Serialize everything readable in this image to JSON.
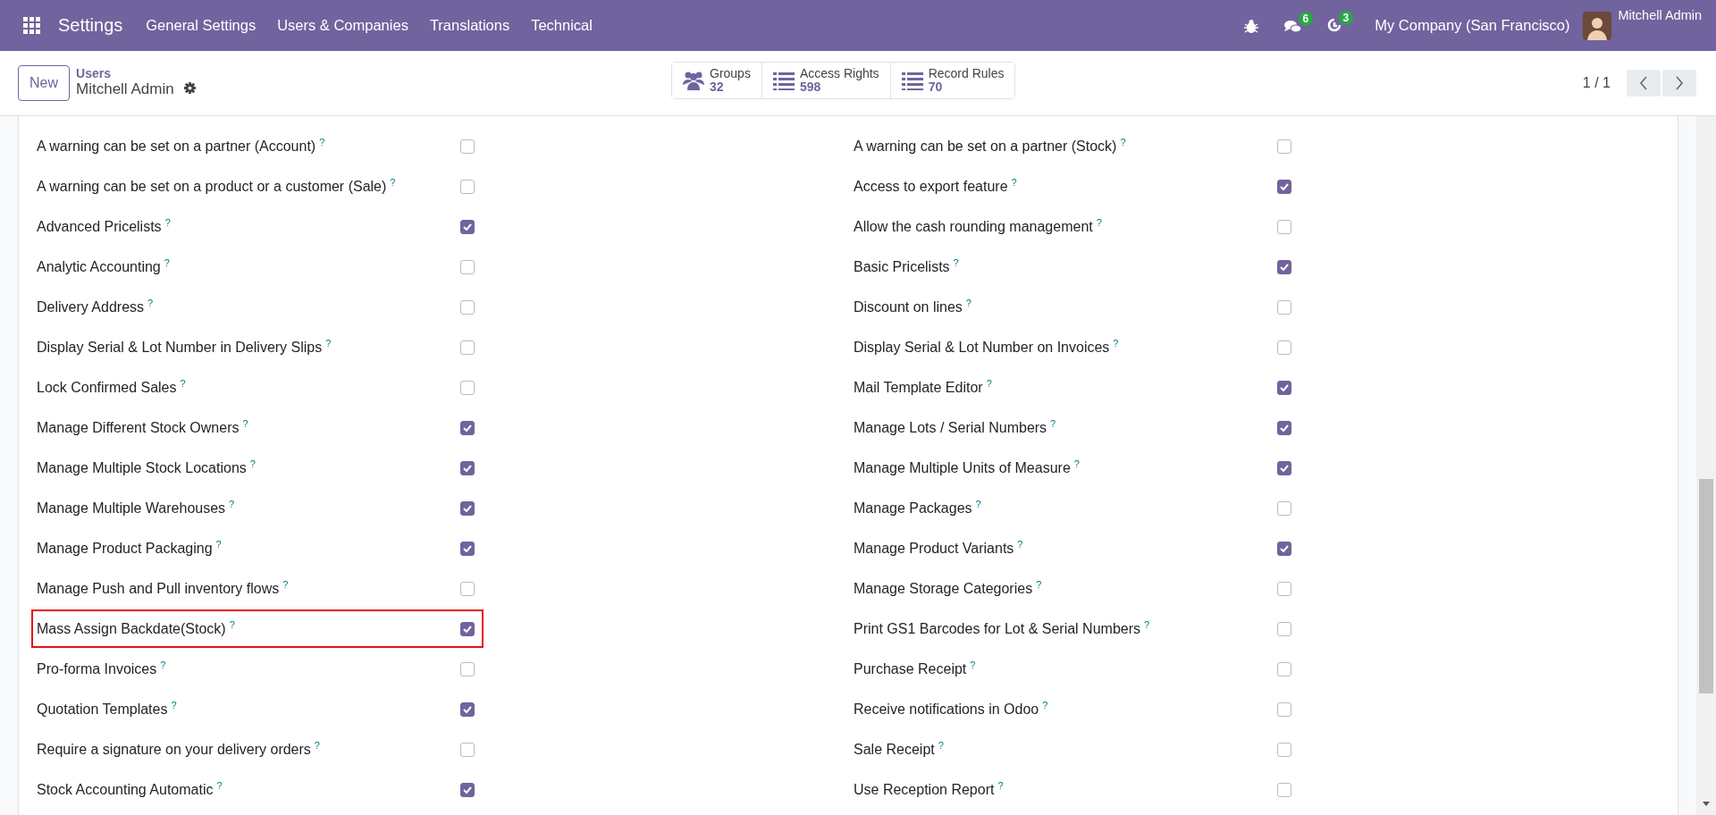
{
  "navbar": {
    "app": "Settings",
    "menus": [
      "General Settings",
      "Users & Companies",
      "Translations",
      "Technical"
    ],
    "messages_badge": "6",
    "activities_badge": "3",
    "company": "My Company (San Francisco)",
    "user": "Mitchell Admin"
  },
  "control_panel": {
    "new_button": "New",
    "breadcrumb_parent": "Users",
    "breadcrumb_current": "Mitchell Admin",
    "stat_buttons": [
      {
        "kind": "users",
        "label": "Groups",
        "value": "32"
      },
      {
        "kind": "list",
        "label": "Access Rights",
        "value": "598"
      },
      {
        "kind": "list",
        "label": "Record Rules",
        "value": "70"
      }
    ],
    "pager": "1 / 1"
  },
  "settings_left": [
    {
      "label": "A warning can be set on a partner (Account)",
      "help": "?",
      "checked": false,
      "highlighted": false
    },
    {
      "label": "A warning can be set on a product or a customer (Sale)",
      "help": "?",
      "checked": false,
      "highlighted": false
    },
    {
      "label": "Advanced Pricelists",
      "help": "?",
      "checked": true,
      "highlighted": false
    },
    {
      "label": "Analytic Accounting",
      "help": "?",
      "checked": false,
      "highlighted": false
    },
    {
      "label": "Delivery Address",
      "help": "?",
      "checked": false,
      "highlighted": false
    },
    {
      "label": "Display Serial & Lot Number in Delivery Slips",
      "help": "?",
      "checked": false,
      "highlighted": false
    },
    {
      "label": "Lock Confirmed Sales",
      "help": "?",
      "checked": false,
      "highlighted": false
    },
    {
      "label": "Manage Different Stock Owners",
      "help": "?",
      "checked": true,
      "highlighted": false
    },
    {
      "label": "Manage Multiple Stock Locations",
      "help": "?",
      "checked": true,
      "highlighted": false
    },
    {
      "label": "Manage Multiple Warehouses",
      "help": "?",
      "checked": true,
      "highlighted": false
    },
    {
      "label": "Manage Product Packaging",
      "help": "?",
      "checked": true,
      "highlighted": false
    },
    {
      "label": "Manage Push and Pull inventory flows",
      "help": "?",
      "checked": false,
      "highlighted": false
    },
    {
      "label": "Mass Assign Backdate(Stock)",
      "help": "?",
      "checked": true,
      "highlighted": true
    },
    {
      "label": "Pro-forma Invoices",
      "help": "?",
      "checked": false,
      "highlighted": false
    },
    {
      "label": "Quotation Templates",
      "help": "?",
      "checked": true,
      "highlighted": false
    },
    {
      "label": "Require a signature on your delivery orders",
      "help": "?",
      "checked": false,
      "highlighted": false
    },
    {
      "label": "Stock Accounting Automatic",
      "help": "?",
      "checked": true,
      "highlighted": false
    }
  ],
  "settings_right": [
    {
      "label": "A warning can be set on a partner (Stock)",
      "help": "?",
      "checked": false,
      "highlighted": false
    },
    {
      "label": "Access to export feature",
      "help": "?",
      "checked": true,
      "highlighted": false
    },
    {
      "label": "Allow the cash rounding management",
      "help": "?",
      "checked": false,
      "highlighted": false
    },
    {
      "label": "Basic Pricelists",
      "help": "?",
      "checked": true,
      "highlighted": false
    },
    {
      "label": "Discount on lines",
      "help": "?",
      "checked": false,
      "highlighted": false
    },
    {
      "label": "Display Serial & Lot Number on Invoices",
      "help": "?",
      "checked": false,
      "highlighted": false
    },
    {
      "label": "Mail Template Editor",
      "help": "?",
      "checked": true,
      "highlighted": false
    },
    {
      "label": "Manage Lots / Serial Numbers",
      "help": "?",
      "checked": true,
      "highlighted": false
    },
    {
      "label": "Manage Multiple Units of Measure",
      "help": "?",
      "checked": true,
      "highlighted": false
    },
    {
      "label": "Manage Packages",
      "help": "?",
      "checked": false,
      "highlighted": false
    },
    {
      "label": "Manage Product Variants",
      "help": "?",
      "checked": true,
      "highlighted": false
    },
    {
      "label": "Manage Storage Categories",
      "help": "?",
      "checked": false,
      "highlighted": false
    },
    {
      "label": "Print GS1 Barcodes for Lot & Serial Numbers",
      "help": "?",
      "checked": false,
      "highlighted": false
    },
    {
      "label": "Purchase Receipt",
      "help": "?",
      "checked": false,
      "highlighted": false
    },
    {
      "label": "Receive notifications in Odoo",
      "help": "?",
      "checked": false,
      "highlighted": false
    },
    {
      "label": "Sale Receipt",
      "help": "?",
      "checked": false,
      "highlighted": false
    },
    {
      "label": "Use Reception Report",
      "help": "?",
      "checked": false,
      "highlighted": false
    }
  ]
}
